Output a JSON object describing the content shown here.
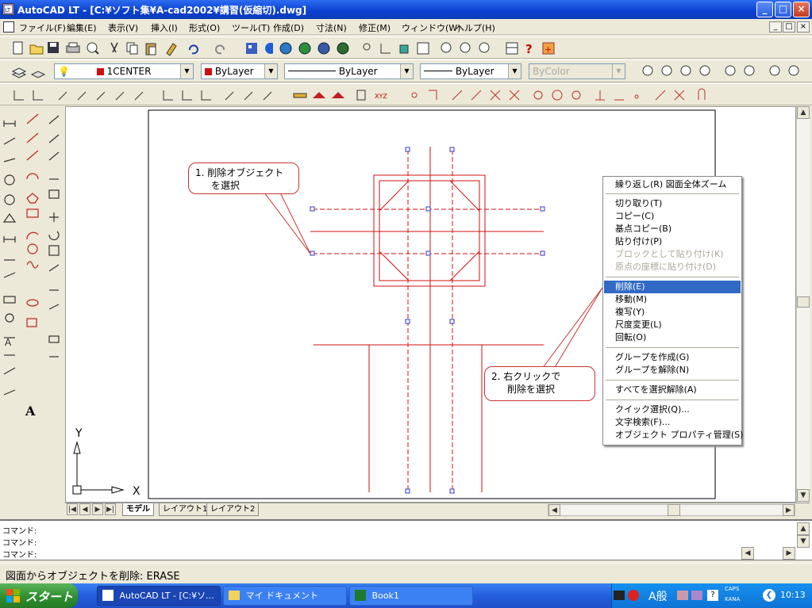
{
  "window": {
    "title": "AutoCAD LT - [C:¥ソフト集¥A-cad2002¥講習(仮縮切).dwg]",
    "app_icon": "autocad-lt-icon",
    "buttons": {
      "minimize": "_",
      "maximize": "□",
      "close": "×"
    }
  },
  "menubar": {
    "items": [
      "ファイル(F)",
      "編集(E)",
      "表示(V)",
      "挿入(I)",
      "形式(O)",
      "ツール(T)",
      "作成(D)",
      "寸法(N)",
      "修正(M)",
      "ウィンドウ(W)",
      "ヘルプ(H)"
    ],
    "mdi_buttons": [
      "_",
      "□",
      "×"
    ]
  },
  "layer_toolbar": {
    "layer_name": "1CENTER",
    "color": "ByLayer",
    "linetype": "ByLayer",
    "lineweight": "ByLayer",
    "plotstyle": "ByColor",
    "layer_color": "#d01010"
  },
  "context_menu": {
    "items": [
      {
        "label": "繰り返し(R) 図面全体ズーム",
        "enabled": true
      },
      {
        "label": "切り取り(T)",
        "enabled": true
      },
      {
        "label": "コピー(C)",
        "enabled": true
      },
      {
        "label": "基点コピー(B)",
        "enabled": true
      },
      {
        "label": "貼り付け(P)",
        "enabled": true
      },
      {
        "label": "ブロックとして貼り付け(K)",
        "enabled": false
      },
      {
        "label": "原点の座標に貼り付け(D)",
        "enabled": false
      },
      {
        "label": "削除(E)",
        "enabled": true,
        "highlighted": true
      },
      {
        "label": "移動(M)",
        "enabled": true
      },
      {
        "label": "複写(Y)",
        "enabled": true
      },
      {
        "label": "尺度変更(L)",
        "enabled": true
      },
      {
        "label": "回転(O)",
        "enabled": true
      },
      {
        "label": "グループを作成(G)",
        "enabled": true
      },
      {
        "label": "グループを解除(N)",
        "enabled": true
      },
      {
        "label": "すべてを選択解除(A)",
        "enabled": true
      },
      {
        "label": "クイック選択(Q)...",
        "enabled": true
      },
      {
        "label": "文字検索(F)...",
        "enabled": true
      },
      {
        "label": "オブジェクト プロパティ管理(S)",
        "enabled": true
      }
    ]
  },
  "annotations": {
    "callout1": {
      "line1": "1. 削除オブジェクト",
      "line2": "を選択"
    },
    "callout2": {
      "line1": "2. 右クリックで",
      "line2": "削除を選択"
    }
  },
  "ucs": {
    "x_label": "X",
    "y_label": "Y"
  },
  "layout_tabs": [
    "モデル",
    "レイアウト1",
    "レイアウト2"
  ],
  "command_lines": [
    "コマンド:",
    "コマンド:",
    "コマンド:"
  ],
  "status_text": "図面からオブジェクトを削除:  ERASE",
  "taskbar": {
    "start": "スタート",
    "tasks": [
      "AutoCAD LT - [C:¥ソ...",
      "マイ ドキュメント",
      "Book1"
    ],
    "tray": {
      "ime": "A般",
      "caps": "CAPS",
      "kana": "KANA",
      "clock": "10:13"
    }
  },
  "colors": {
    "accent": "#316ac5",
    "drawing_red": "#d01010",
    "grip": "#3333cc"
  }
}
